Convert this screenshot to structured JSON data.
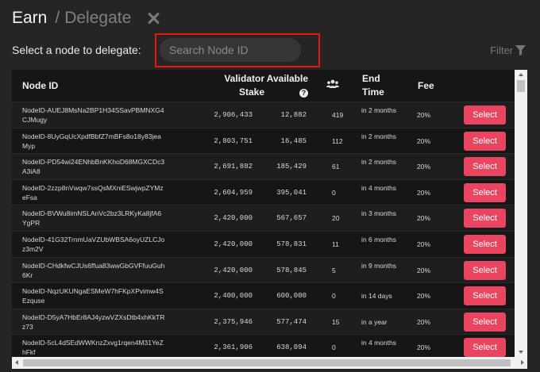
{
  "header": {
    "title": "Earn",
    "separator": "/",
    "subtitle": "Delegate"
  },
  "prompt": "Select a node to delegate:",
  "search": {
    "placeholder": "Search Node ID",
    "value": ""
  },
  "filter": {
    "label": "Filter"
  },
  "columns": {
    "node_id": "Node ID",
    "stake_line1": "Validator",
    "stake_line2": "Stake",
    "available": "Available",
    "delegators_icon": "users-icon",
    "end_line1": "End",
    "end_line2": "Time",
    "fee": "Fee"
  },
  "rows": [
    {
      "node_id": "NodeID-AUEJ8MsNa2BP1H34SSavPBMNXG4CJMugy",
      "stake": "2,906,433",
      "available": "12,882",
      "delegators": "419",
      "end_time": "in 2 months",
      "fee": "20%",
      "action": "Select"
    },
    {
      "node_id": "NodeID-8UyGqUcXpdfBbfZ7mBFs8o18y83jeaMyp",
      "stake": "2,803,751",
      "available": "16,485",
      "delegators": "112",
      "end_time": "in 2 months",
      "fee": "20%",
      "action": "Select"
    },
    {
      "node_id": "NodeID-PD54wi24ENhbBnKKhoD68MGXCDc3A3iA8",
      "stake": "2,691,882",
      "available": "185,429",
      "delegators": "61",
      "end_time": "in 2 months",
      "fee": "20%",
      "action": "Select"
    },
    {
      "node_id": "NodeID-2zzp8nVwqw7ssQsMXniESwjwpZYMzeFsa",
      "stake": "2,604,959",
      "available": "395,041",
      "delegators": "0",
      "end_time": "in 4 months",
      "fee": "20%",
      "action": "Select"
    },
    {
      "node_id": "NodeID-BVWu8imNSLAnVc2bz3LRKyKa8jfA6YgPR",
      "stake": "2,420,000",
      "available": "567,657",
      "delegators": "20",
      "end_time": "in 3 months",
      "fee": "20%",
      "action": "Select"
    },
    {
      "node_id": "NodeID-41G32TrnmUaVZUbWBSA6oyUZLCJoz3m2V",
      "stake": "2,420,000",
      "available": "578,831",
      "delegators": "11",
      "end_time": "in 6 months",
      "fee": "20%",
      "action": "Select"
    },
    {
      "node_id": "NodeID-CHdkfwCJUs6ffua83wwGbGVFfuuGuh6Kr",
      "stake": "2,420,000",
      "available": "578,845",
      "delegators": "5",
      "end_time": "in 9 months",
      "fee": "20%",
      "action": "Select"
    },
    {
      "node_id": "NodeID-NqzUKUNgaESMeW7hFKpXPvimw4SEzquse",
      "stake": "2,400,000",
      "available": "600,000",
      "delegators": "0",
      "end_time": "in 14 days",
      "fee": "20%",
      "action": "Select"
    },
    {
      "node_id": "NodeID-D5yA7HbEr8AJ4yzwVZXsDtb4xhKkTRz73",
      "stake": "2,375,946",
      "available": "577,474",
      "delegators": "15",
      "end_time": "in a year",
      "fee": "20%",
      "action": "Select"
    },
    {
      "node_id": "NodeID-5cL4dSEdWWKnzZxvg1rqen4M31YeZhFkf",
      "stake": "2,361,906",
      "available": "638,094",
      "delegators": "0",
      "end_time": "in 4 months",
      "fee": "20%",
      "action": "Select"
    }
  ],
  "colors": {
    "accent": "#e94560",
    "highlight_box": "#e81515",
    "background": "#252526",
    "table_bg": "#161616"
  }
}
